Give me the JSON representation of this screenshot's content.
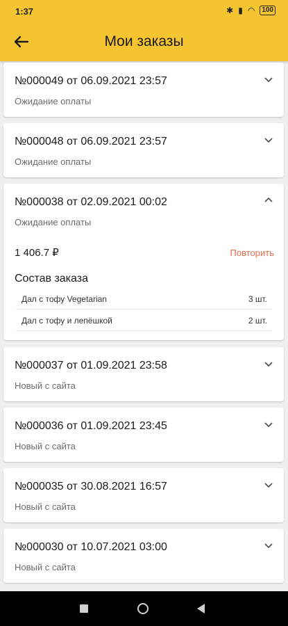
{
  "status_bar": {
    "time": "1:37",
    "battery": "100"
  },
  "app_bar": {
    "title": "Мои заказы"
  },
  "orders": [
    {
      "header": "№000049 от 06.09.2021 23:57",
      "status": "Ожидание оплаты"
    },
    {
      "header": "№000048 от 06.09.2021 23:57",
      "status": "Ожидание оплаты"
    },
    {
      "header": "№000038 от 02.09.2021 00:02",
      "status": "Ожидание оплаты",
      "expanded": true,
      "total": "1 406.7 ₽",
      "repeat_label": "Повторить",
      "composition_title": "Состав заказа",
      "items": [
        {
          "name": "Дал с тофу Vegetarian",
          "qty": "3 шт."
        },
        {
          "name": "Дал с тофу и лепёшкой",
          "qty": "2 шт."
        }
      ]
    },
    {
      "header": "№000037 от 01.09.2021 23:58",
      "status": "Новый с сайта"
    },
    {
      "header": "№000036 от 01.09.2021 23:45",
      "status": "Новый с сайта"
    },
    {
      "header": "№000035 от 30.08.2021 16:57",
      "status": "Новый с сайта"
    },
    {
      "header": "№000030 от 10.07.2021 03:00",
      "status": "Новый с сайта"
    }
  ]
}
